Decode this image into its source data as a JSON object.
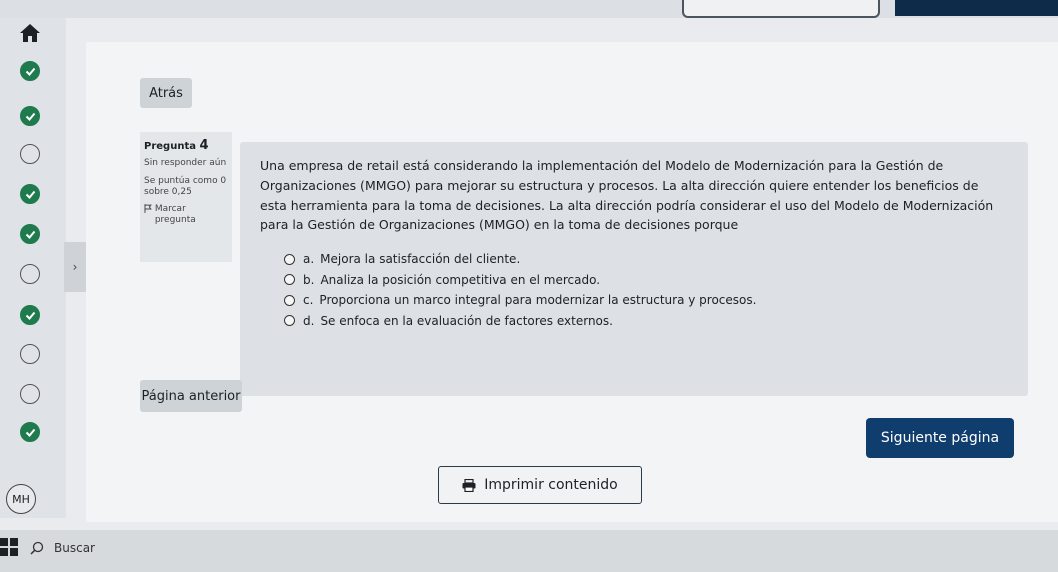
{
  "nav": {
    "avatar_initials": "MH"
  },
  "buttons": {
    "back": "Atrás",
    "prev_page": "Página anterior",
    "next_page": "Siguiente página",
    "print": "Imprimir contenido"
  },
  "question": {
    "number_label": "Pregunta",
    "number": "4",
    "state": "Sin responder aún",
    "grade": "Se puntúa como 0 sobre 0,25",
    "flag_label": "Marcar pregunta",
    "text": "Una empresa de retail está considerando la implementación del Modelo de Modernización para la Gestión de Organizaciones (MMGO) para mejorar su estructura y procesos. La alta dirección quiere entender los beneficios de esta herramienta para la toma de decisiones. La alta dirección podría considerar el uso del Modelo de Modernización para la Gestión de Organizaciones (MMGO) en la toma de decisiones porque",
    "answers": [
      {
        "letter": "a.",
        "text": "Mejora la satisfacción del cliente."
      },
      {
        "letter": "b.",
        "text": "Analiza la posición competitiva en el mercado."
      },
      {
        "letter": "c.",
        "text": "Proporciona un marco integral para modernizar la estructura y procesos."
      },
      {
        "letter": "d.",
        "text": "Se enfoca en la evaluación de factores externos."
      }
    ]
  },
  "taskbar": {
    "search_label": "Buscar"
  },
  "colors": {
    "done": "#1f7a4d",
    "primary": "#0f3d6e"
  }
}
